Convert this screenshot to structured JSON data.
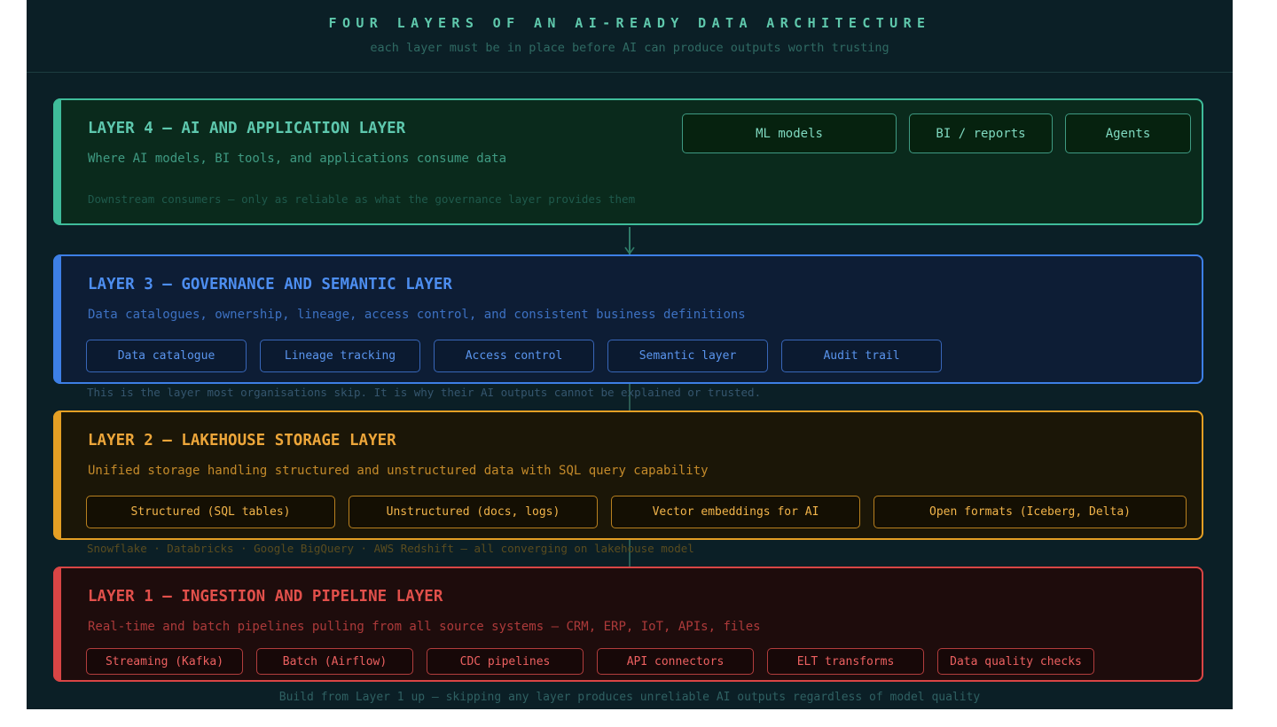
{
  "header": {
    "title": "FOUR LAYERS OF AN AI-READY DATA ARCHITECTURE",
    "subtitle": "each layer must be in place before AI can produce outputs worth trusting"
  },
  "layers": [
    {
      "id": "layer-4",
      "name": "LAYER 4 — AI AND APPLICATION LAYER",
      "description": "Where AI models, BI tools, and applications consume data",
      "note": "Downstream consumers — only as reliable as what the governance layer provides them",
      "chips": [
        "ML models",
        "BI / reports",
        "Agents"
      ],
      "color": "#3fbc9a"
    },
    {
      "id": "layer-3",
      "name": "LAYER 3 — GOVERNANCE AND SEMANTIC LAYER",
      "description": "Data catalogues, ownership, lineage, access control, and consistent business definitions",
      "chips": [
        "Data catalogue",
        "Lineage tracking",
        "Access control",
        "Semantic layer",
        "Audit trail"
      ],
      "note_below": "This is the layer most organisations skip. It is why their AI outputs cannot be explained or trusted.",
      "color": "#3d7fe6"
    },
    {
      "id": "layer-2",
      "name": "LAYER 2 — LAKEHOUSE STORAGE LAYER",
      "description": "Unified storage handling structured and unstructured data with SQL query capability",
      "chips": [
        "Structured (SQL tables)",
        "Unstructured (docs, logs)",
        "Vector embeddings for AI",
        "Open formats (Iceberg, Delta)"
      ],
      "note_below": "Snowflake · Databricks · Google BigQuery · AWS Redshift — all converging on lakehouse model",
      "color": "#e49f24"
    },
    {
      "id": "layer-1",
      "name": "LAYER 1 — INGESTION AND PIPELINE LAYER",
      "description": "Real-time and batch pipelines pulling from all source systems — CRM, ERP, IoT, APIs, files",
      "chips": [
        "Streaming (Kafka)",
        "Batch (Airflow)",
        "CDC pipelines",
        "API connectors",
        "ELT transforms",
        "Data quality checks"
      ],
      "color": "#d94545"
    }
  ],
  "footer": "Build from Layer 1 up — skipping any layer produces unreliable AI outputs regardless of model quality"
}
